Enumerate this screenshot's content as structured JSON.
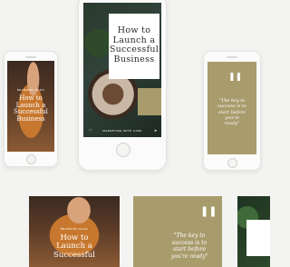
{
  "main_phone": {
    "title_lines": [
      "How to",
      "Launch a",
      "Successful",
      "Business"
    ],
    "footer_text": "MARKETING WITH CARE",
    "footer_icon": "heart-icon",
    "footer_icon_2": "send-icon"
  },
  "left_phone": {
    "brand": "BRANDING BLOG",
    "title_lines": [
      "How to",
      "Launch a",
      "Successful",
      "Business"
    ]
  },
  "right_phone": {
    "quote_lines": [
      "\"The key to",
      "success is to",
      "start before",
      "you're",
      "ready\""
    ],
    "icon": "quote-icon"
  },
  "bottom_post_1": {
    "brand": "BRANDING BLOG",
    "title_lines": [
      "How to",
      "Launch a",
      "Successful"
    ]
  },
  "bottom_post_2": {
    "quote_lines": [
      "\"The key to",
      "success is to",
      "start before",
      "you're ready\""
    ],
    "icon": "quote-icon"
  },
  "colors": {
    "olive": "#a89c6d",
    "background": "#f3f3f1",
    "card": "#ffffff"
  }
}
